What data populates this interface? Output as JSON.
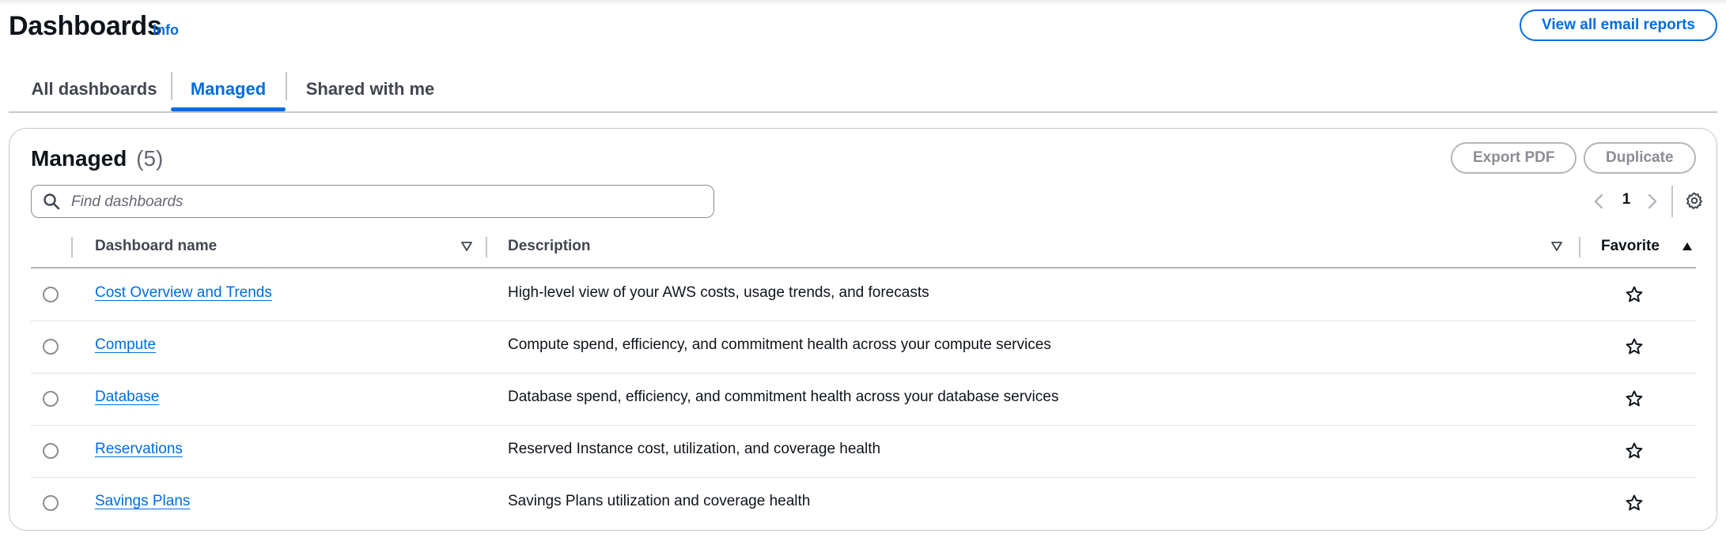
{
  "header": {
    "title": "Dashboards",
    "info_label": "Info",
    "email_button": "View all email reports"
  },
  "tabs": [
    {
      "label": "All dashboards",
      "active": false
    },
    {
      "label": "Managed",
      "active": true
    },
    {
      "label": "Shared with me",
      "active": false
    }
  ],
  "panel": {
    "title": "Managed",
    "count": "(5)",
    "export_button": "Export PDF",
    "duplicate_button": "Duplicate",
    "search_placeholder": "Find dashboards",
    "page": "1"
  },
  "table": {
    "columns": {
      "name": "Dashboard name",
      "description": "Description",
      "favorite": "Favorite"
    },
    "rows": [
      {
        "name": "Cost Overview and Trends",
        "description": "High-level view of your AWS costs, usage trends, and forecasts"
      },
      {
        "name": "Compute",
        "description": "Compute spend, efficiency, and commitment health across your compute services"
      },
      {
        "name": "Database",
        "description": "Database spend, efficiency, and commitment health across your database services"
      },
      {
        "name": "Reservations",
        "description": "Reserved Instance cost, utilization, and coverage health"
      },
      {
        "name": "Savings Plans",
        "description": "Savings Plans utilization and coverage health"
      }
    ]
  },
  "colors": {
    "accent": "#006ce0",
    "text": "#0f141a",
    "muted": "#656871",
    "border": "#c6c6cd"
  },
  "icons": [
    "search-icon",
    "chevron-left-icon",
    "chevron-right-icon",
    "gear-icon",
    "sort-icon",
    "star-icon",
    "radio-icon"
  ]
}
